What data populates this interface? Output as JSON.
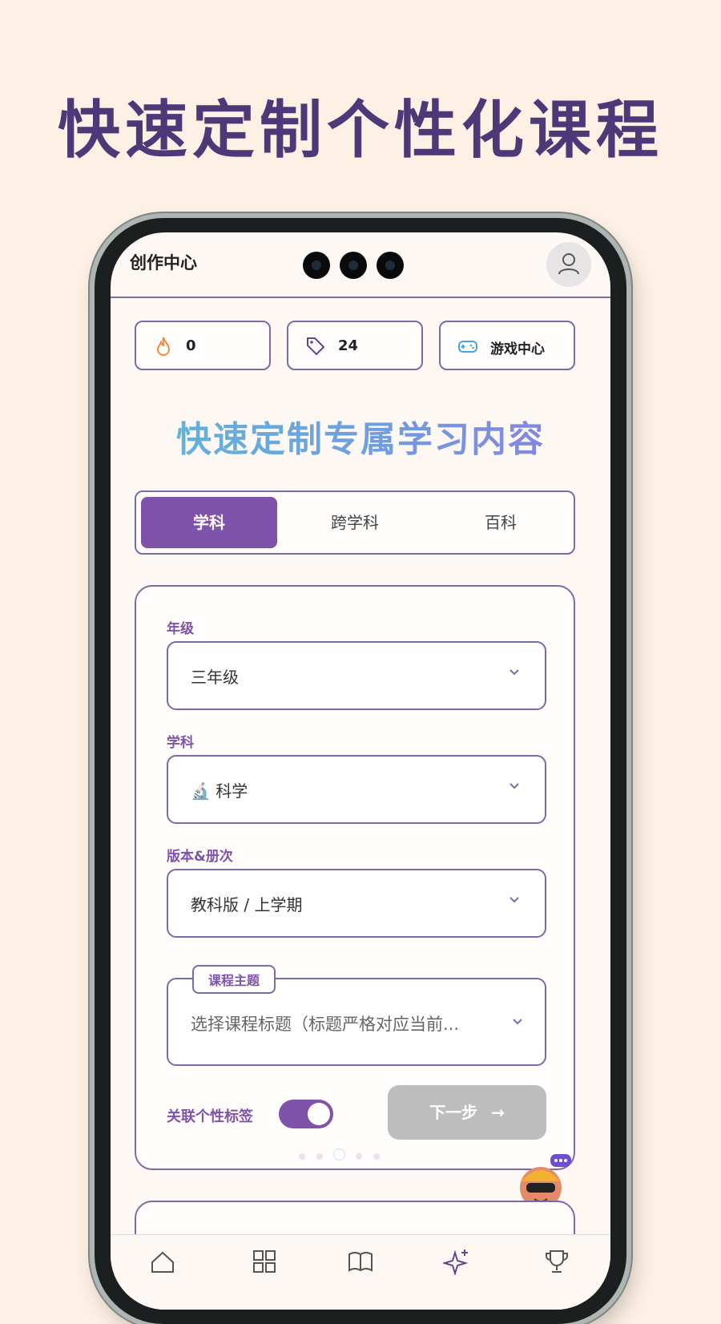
{
  "headline": "快速定制个性化课程",
  "app": {
    "title": "创作中心",
    "avatar_icon": "user-icon"
  },
  "stats": [
    {
      "icon": "flame-icon",
      "value": "0",
      "color": "#f08a3c"
    },
    {
      "icon": "tag-icon",
      "value": "24",
      "color": "#5b4a8e"
    },
    {
      "icon": "gamepad-icon",
      "value": "游戏中心",
      "color": "#4aa6d8"
    }
  ],
  "subtitle": "快速定制专属学习内容",
  "tabs": [
    {
      "label": "学科",
      "active": true
    },
    {
      "label": "跨学科",
      "active": false
    },
    {
      "label": "百科",
      "active": false
    }
  ],
  "form": {
    "grade": {
      "label": "年级",
      "value": "三年级"
    },
    "subject": {
      "label": "学科",
      "value": "🔬 科学"
    },
    "edition": {
      "label": "版本&册次",
      "value": "教科版 / 上学期"
    },
    "topic": {
      "label": "课程主题",
      "placeholder": "选择课程标题（标题严格对应当前..."
    },
    "link_tags": {
      "label": "关联个性标签",
      "on": true
    },
    "next_button": "下一步",
    "next_arrow": "→"
  },
  "carousel": {
    "count": 5,
    "active_index": 2
  },
  "nav": {
    "icons": [
      "home-icon",
      "grid-icon",
      "book-icon",
      "sparkle-icon",
      "trophy-icon"
    ]
  },
  "colors": {
    "accent": "#7f53aa",
    "border": "#7a6aa8",
    "headline": "#4d3878",
    "background": "#fdf0e4"
  }
}
